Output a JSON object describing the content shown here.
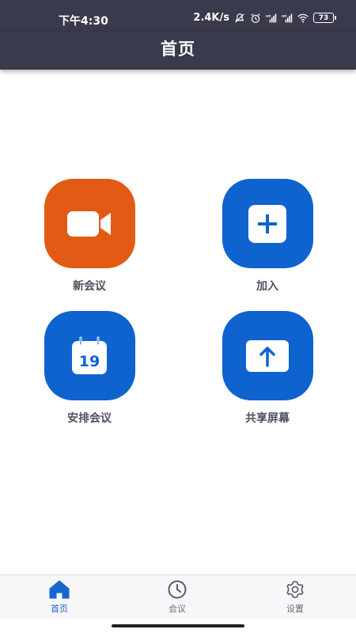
{
  "status_bar": {
    "time": "下午4:30",
    "network_speed": "2.4K/s",
    "battery": "73",
    "icons": [
      "mute-icon",
      "alarm-icon",
      "signal-hd-icon",
      "signal-hd-icon",
      "wifi-icon",
      "battery-icon"
    ]
  },
  "header": {
    "title": "首页"
  },
  "actions": [
    {
      "label": "新会议",
      "icon": "video-camera-icon",
      "color": "#e35a14"
    },
    {
      "label": "加入",
      "icon": "plus-icon",
      "color": "#0e63cf"
    },
    {
      "label": "安排会议",
      "icon": "calendar-icon",
      "color": "#0e63cf",
      "calendar_day": "19"
    },
    {
      "label": "共享屏幕",
      "icon": "upload-arrow-icon",
      "color": "#0e63cf"
    }
  ],
  "nav": {
    "items": [
      {
        "label": "首页",
        "icon": "home-icon",
        "active": true
      },
      {
        "label": "会议",
        "icon": "clock-icon",
        "active": false
      },
      {
        "label": "设置",
        "icon": "gear-icon",
        "active": false
      }
    ]
  },
  "colors": {
    "header_bg": "#3a3a4d",
    "accent": "#1866d0",
    "orange": "#e35a14",
    "blue": "#0e63cf"
  }
}
